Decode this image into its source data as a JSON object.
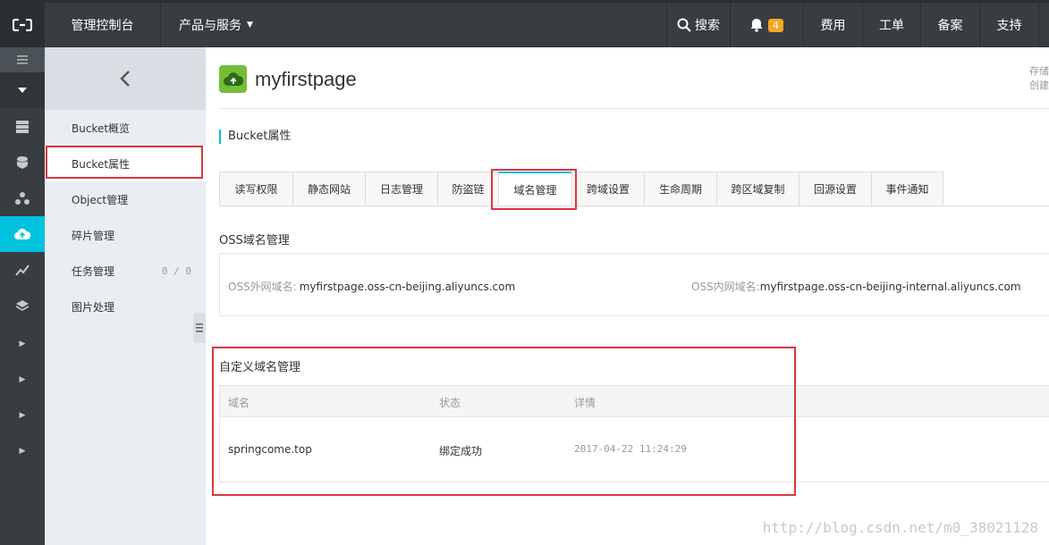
{
  "topbar": {
    "logo_icon": "aliyun-logo-icon",
    "console": "管理控制台",
    "products": "产品与服务",
    "search": "搜索",
    "notifications_count": "4",
    "fee": "费用",
    "order": "工单",
    "record": "备案",
    "support": "支持"
  },
  "sidebar": {
    "back_icon": "chevron-left-icon",
    "items": [
      {
        "label": "Bucket概览"
      },
      {
        "label": "Bucket属性"
      },
      {
        "label": "Object管理"
      },
      {
        "label": "碎片管理"
      },
      {
        "label": "任务管理",
        "count": "0 / 0"
      },
      {
        "label": "图片处理"
      }
    ]
  },
  "bucket": {
    "name": "myfirstpage",
    "meta_line1": "存储",
    "meta_line2": "创建"
  },
  "section": {
    "title": "Bucket属性"
  },
  "tabs": [
    {
      "label": "读写权限"
    },
    {
      "label": "静态网站"
    },
    {
      "label": "日志管理"
    },
    {
      "label": "防盗链"
    },
    {
      "label": "域名管理"
    },
    {
      "label": "跨域设置"
    },
    {
      "label": "生命周期"
    },
    {
      "label": "跨区域复制"
    },
    {
      "label": "回源设置"
    },
    {
      "label": "事件通知"
    }
  ],
  "oss_domain": {
    "title": "OSS域名管理",
    "external_label": "OSS外网域名:",
    "external_value": "myfirstpage.oss-cn-beijing.aliyuncs.com",
    "internal_label": "OSS内网域名:",
    "internal_value": "myfirstpage.oss-cn-beijing-internal.aliyuncs.com"
  },
  "custom_domain": {
    "title": "自定义域名管理",
    "columns": [
      "域名",
      "状态",
      "详情"
    ],
    "rows": [
      {
        "domain": "springcome.top",
        "status": "绑定成功",
        "detail": "2017-04-22 11:24:29"
      }
    ]
  },
  "watermark": "http://blog.csdn.net/m0_38021128",
  "colors": {
    "accent": "#00c1de",
    "topbar": "#373d41",
    "annotation": "#d9363e"
  }
}
